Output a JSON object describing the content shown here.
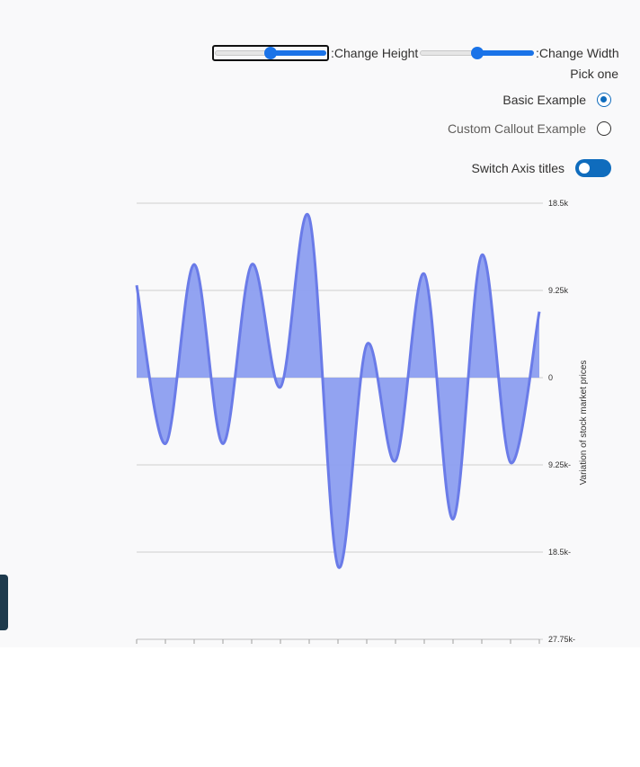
{
  "controls": {
    "height_label": ":Change Height",
    "height_value": 0.5,
    "width_label": ":Change Width",
    "width_value": 0.5,
    "pick_label": "Pick one",
    "radios": [
      {
        "label": "Basic Example",
        "checked": true
      },
      {
        "label": "Custom Callout Example",
        "checked": false
      }
    ],
    "toggle_label": "Switch Axis titles",
    "toggle_on": true
  },
  "colors": {
    "accent": "#0f6cbd",
    "area_fill": "#8c9ef0",
    "area_line": "#6a7be8"
  },
  "chart_data": {
    "type": "area",
    "ylabel": "Variation of stock market prices",
    "ylim": [
      -27750,
      18500
    ],
    "yticks": [
      18500,
      9250,
      0,
      -9250,
      -18500,
      -27750
    ],
    "ytick_labels": [
      "18.5k",
      "9.25k",
      "0",
      "9.25k-",
      "18.5k-",
      "27.75k-"
    ],
    "x": [
      0,
      1,
      2,
      3,
      4,
      5,
      6,
      7,
      8,
      9,
      10,
      11,
      12,
      13,
      14
    ],
    "values": [
      9800,
      -7000,
      12000,
      -7000,
      12000,
      -1000,
      17000,
      -20000,
      3500,
      -8800,
      11000,
      -15000,
      13000,
      -9000,
      7000
    ],
    "xticks": 15
  }
}
